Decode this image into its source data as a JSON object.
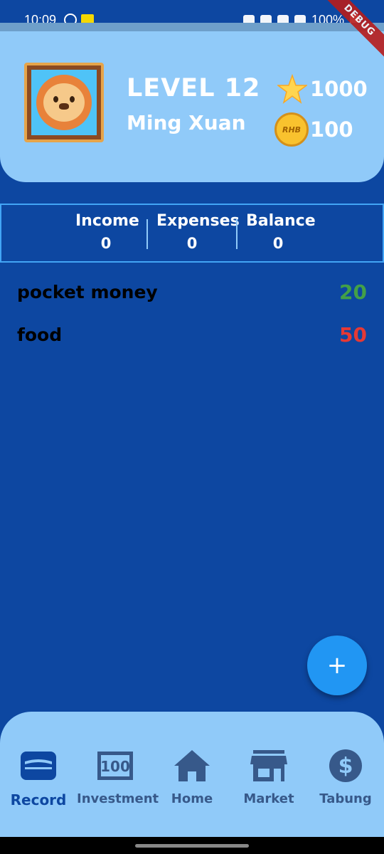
{
  "status_bar": {
    "time": "10:09",
    "battery": "100%",
    "debug_label": "DEBUG"
  },
  "profile": {
    "level": "LEVEL 12",
    "name": "Ming Xuan",
    "stars": "1000",
    "coins": "100",
    "coin_label": "RHB",
    "avatar": "lion-avatar-icon"
  },
  "summary": {
    "income_label": "Income",
    "income_value": "0",
    "expenses_label": "Expenses",
    "expenses_value": "0",
    "balance_label": "Balance",
    "balance_value": "0"
  },
  "transactions": [
    {
      "description": "pocket money",
      "amount": "20",
      "type": "income"
    },
    {
      "description": "food",
      "amount": "50",
      "type": "expense"
    }
  ],
  "fab": {
    "label": "+"
  },
  "nav": {
    "items": [
      {
        "label": "Record",
        "icon": "wallet-icon",
        "active": true
      },
      {
        "label": "Investment",
        "icon": "banknote-icon",
        "active": false
      },
      {
        "label": "Home",
        "icon": "home-icon",
        "active": false
      },
      {
        "label": "Market",
        "icon": "store-icon",
        "active": false
      },
      {
        "label": "Tabung",
        "icon": "dollar-coin-icon",
        "active": false
      }
    ],
    "investment_note": "100"
  },
  "colors": {
    "background": "#0d47a1",
    "card": "#90caf9",
    "income": "#43a047",
    "expense": "#e53935",
    "fab": "#2196f3"
  }
}
